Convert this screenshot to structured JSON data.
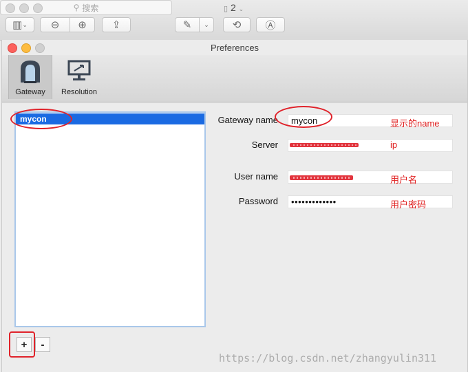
{
  "outer_window": {
    "title": "2",
    "search_placeholder": "搜索"
  },
  "prefs_window": {
    "title": "Preferences",
    "tabs": [
      {
        "label": "Gateway",
        "selected": true
      },
      {
        "label": "Resolution",
        "selected": false
      }
    ]
  },
  "gateway_list": {
    "items": [
      "mycon"
    ],
    "add_label": "+",
    "remove_label": "-"
  },
  "form": {
    "gateway_name_label": "Gateway name",
    "gateway_name_value": "mycon",
    "server_label": "Server",
    "user_name_label": "User name",
    "password_label": "Password",
    "password_value": "•••••••••••••"
  },
  "annotations": {
    "gateway_name_note": "显示的name",
    "server_note": "ip",
    "user_name_note": "用户名",
    "password_note": "用户密码"
  },
  "watermark": "https://blog.csdn.net/zhangyulin311",
  "colors": {
    "selection": "#1a6ae2",
    "annotation": "#e02020",
    "close_button": "#fc615d",
    "minimize_button": "#fdbc40"
  }
}
